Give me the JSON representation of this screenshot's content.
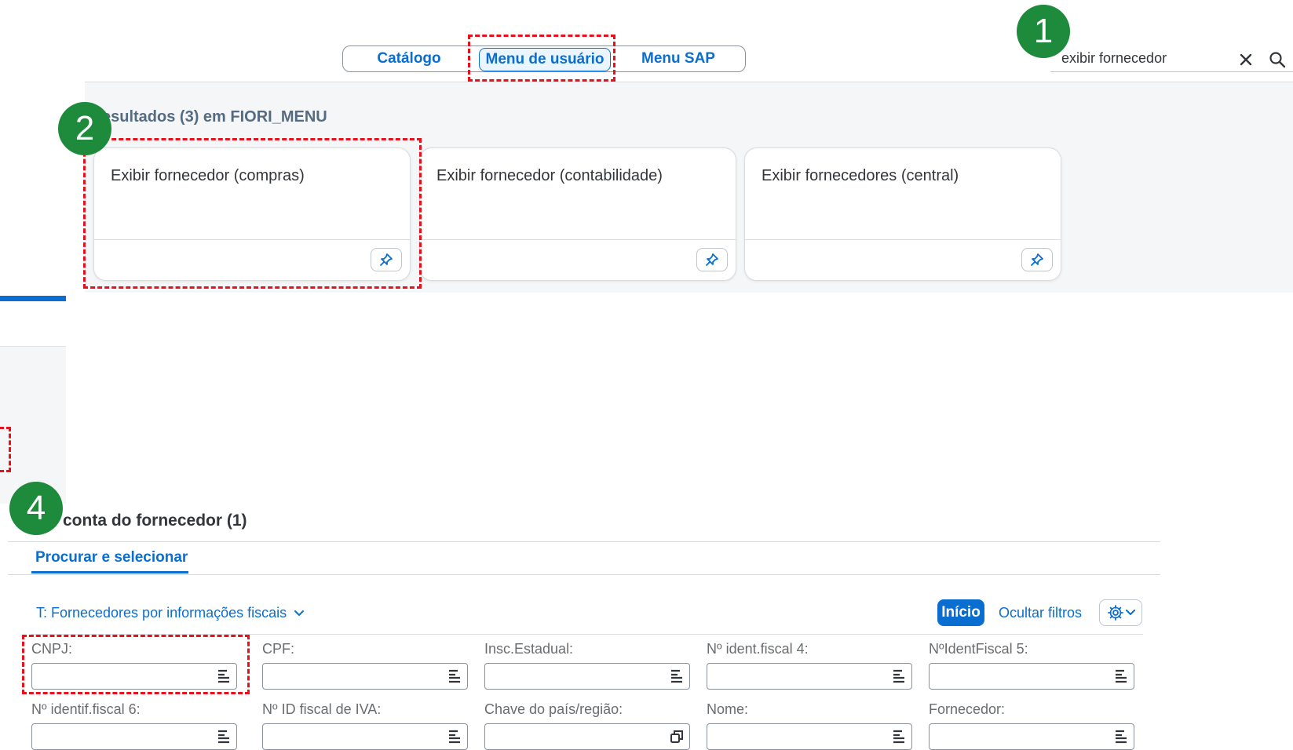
{
  "top": {
    "segments": [
      "Catálogo",
      "Menu de usuário",
      "Menu SAP"
    ],
    "active_segment": "Menu de usuário",
    "search_value": "exibir fornecedor"
  },
  "results": {
    "title": "esultados (3) em FIORI_MENU",
    "tiles": [
      {
        "title": "Exibir fornecedor (compras)"
      },
      {
        "title": "Exibir fornecedor (contabilidade)"
      },
      {
        "title": "Exibir fornecedores (central)"
      }
    ]
  },
  "badges": [
    "1",
    "2",
    "4"
  ],
  "form": {
    "section_title": "conta do fornecedor (1)",
    "tab_label": "Procurar e selecionar",
    "variant_label": "T: Fornecedores por informações fiscais",
    "start_button": "Início",
    "hide_filters": "Ocultar filtros",
    "row1": [
      "CNPJ:",
      "CPF:",
      "Insc.Estadual:",
      "Nº ident.fiscal 4:",
      "NºIdentFiscal 5:"
    ],
    "row2": [
      "Nº identif.fiscal 6:",
      "Nº ID fiscal de IVA:",
      "Chave do país/região:",
      "Nome:",
      "Fornecedor:"
    ]
  },
  "colors": {
    "accent": "#0a6ed1",
    "badge": "#1e8a3c",
    "highlight": "#e8101a"
  }
}
